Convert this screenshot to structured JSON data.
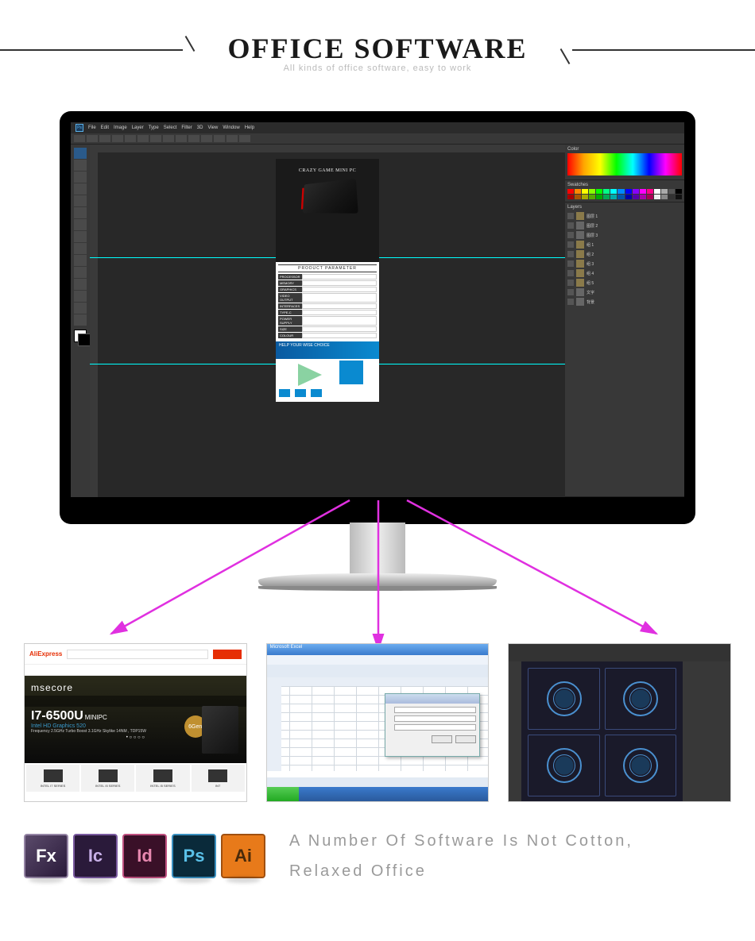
{
  "header": {
    "title": "OFFICE SOFTWARE",
    "subtitle": "All kinds of office software, easy to work"
  },
  "photoshop": {
    "menu": [
      "File",
      "Edit",
      "Image",
      "Layer",
      "Type",
      "Select",
      "Filter",
      "3D",
      "View",
      "Window",
      "Help"
    ],
    "doc": {
      "title": "CRAZY GAME MINI PC",
      "paramHeader": "PRODUCT PARAMETER",
      "params": [
        {
          "k": "PROCESSOR",
          "v": ""
        },
        {
          "k": "MEMORY",
          "v": ""
        },
        {
          "k": "GRAPHICS",
          "v": ""
        },
        {
          "k": "VIDEO OUTPUT",
          "v": ""
        },
        {
          "k": "INTERFACES",
          "v": ""
        },
        {
          "k": "TYPE-C",
          "v": ""
        },
        {
          "k": "POWER SUPPLY",
          "v": ""
        },
        {
          "k": "SIZE",
          "v": ""
        },
        {
          "k": "COLOUR",
          "v": ""
        }
      ],
      "blueTitle": "HELP YOUR WISE CHOICE"
    },
    "panels": {
      "colorTab": "Color",
      "swatchesTab": "Swatches",
      "layersTab": "Layers",
      "layers": [
        "图层 1",
        "图层 2",
        "图层 3",
        "组 1",
        "组 2",
        "组 3",
        "组 4",
        "组 5",
        "文字",
        "背景"
      ]
    }
  },
  "thumb1": {
    "logo": "AliExpress",
    "brand": "msecore",
    "cpu": "I7-6500U",
    "minipc": "MINIPC",
    "gpu": "Intel HD Graphics 520",
    "spec": "Frequency 2.5GHz Turbo Boost 3.1GHz Skylike 14NM , TDP15W",
    "badge": "6Gen",
    "cards": [
      "INTEL I7 SERIES",
      "INTEL I5 SERIES",
      "INTEL I5 SERIES",
      "INT"
    ]
  },
  "thumb2": {
    "title": "Microsoft Excel"
  },
  "softwareIcons": [
    {
      "id": "fx",
      "label": "Fx"
    },
    {
      "id": "ic",
      "label": "Ic"
    },
    {
      "id": "id",
      "label": "Id"
    },
    {
      "id": "ps",
      "label": "Ps"
    },
    {
      "id": "ai",
      "label": "Ai"
    }
  ],
  "bottomText": {
    "line1": "A Number Of Software Is Not Cotton,",
    "line2": "Relaxed Office"
  }
}
